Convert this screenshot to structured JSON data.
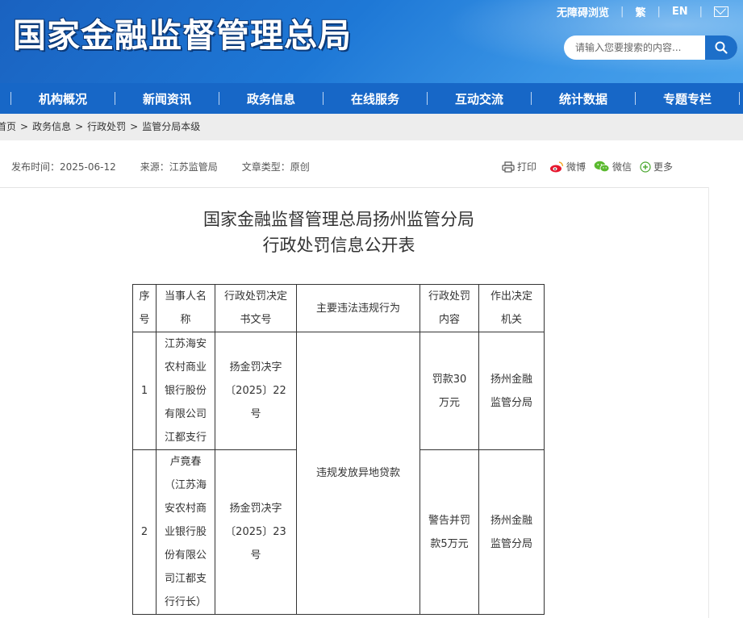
{
  "header": {
    "logo": "国家金融监督管理总局",
    "links": [
      "无障碍浏览",
      "繁",
      "EN"
    ],
    "search_placeholder": "请输入您要搜索的内容..."
  },
  "nav": [
    "机构概况",
    "新闻资讯",
    "政务信息",
    "在线服务",
    "互动交流",
    "统计数据",
    "专题专栏"
  ],
  "breadcrumb": [
    "首页",
    "政务信息",
    "行政处罚",
    "监管分局本级"
  ],
  "meta": {
    "publish": "发布时间：2025-06-12",
    "source": "来源：江苏监管局",
    "type": "文章类型：原创"
  },
  "share": [
    "打印",
    "微博",
    "微信",
    "更多"
  ],
  "title": [
    "国家金融监督管理总局扬州监管分局",
    "行政处罚信息公开表"
  ],
  "table": {
    "headers": [
      [
        "序",
        "号"
      ],
      [
        "当事人名",
        "称"
      ],
      [
        "行政处罚决定",
        "书文号"
      ],
      [
        "主要违法违规行为"
      ],
      [
        "行政处罚",
        "内容"
      ],
      [
        "作出决定",
        "机关"
      ]
    ],
    "violation": "违规发放异地贷款",
    "rows": [
      {
        "no": "1",
        "party": [
          "江苏海安",
          "农村商业",
          "银行股份",
          "有限公司",
          "江都支行"
        ],
        "doc": [
          "扬金罚决字",
          "〔2025〕22",
          "号"
        ],
        "penalty": [
          "罚款30",
          "万元"
        ],
        "authority": [
          "扬州金融",
          "监管分局"
        ]
      },
      {
        "no": "2",
        "party": [
          "卢竟春",
          "（江苏海",
          "安农村商",
          "业银行股",
          "份有限公",
          "司江都支",
          "行行长）"
        ],
        "doc": [
          "扬金罚决字",
          "〔2025〕23",
          "号"
        ],
        "penalty": [
          "警告并罚",
          "款5万元"
        ],
        "authority": [
          "扬州金融",
          "监管分局"
        ]
      }
    ]
  }
}
